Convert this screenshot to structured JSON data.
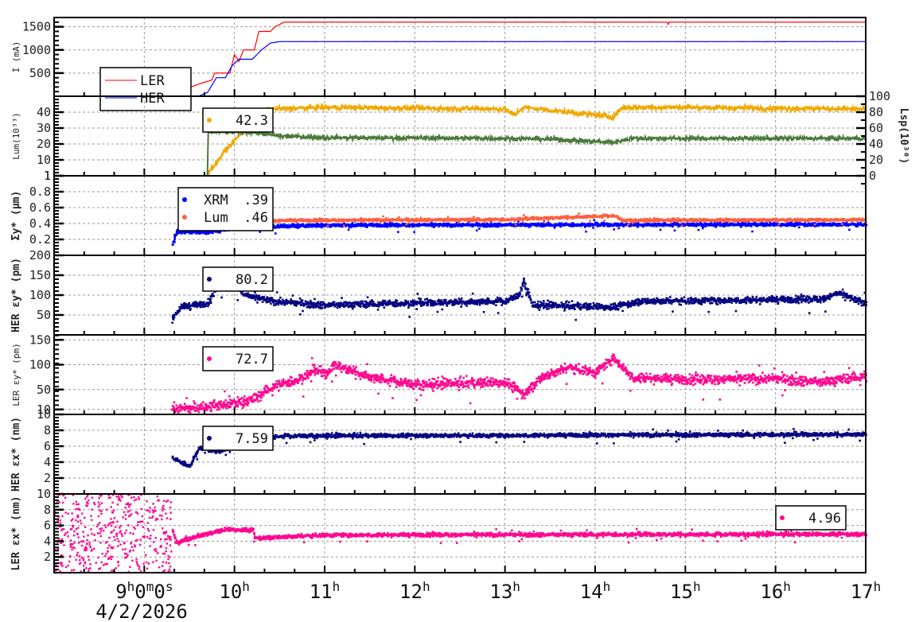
{
  "chart_data": [
    {
      "type": "line",
      "id": "current",
      "ylabel": "I (mA)",
      "ylabel_style": "light",
      "ylim": [
        0,
        1700
      ],
      "yticks": [
        500,
        1000,
        1500
      ],
      "ytick_labels": [
        "500",
        "1000",
        "1500"
      ],
      "series": [
        {
          "name": "LER",
          "color": "#ff0000",
          "noise": 2,
          "points": [
            [
              8,
              0
            ],
            [
              9.3,
              0
            ],
            [
              9.45,
              150
            ],
            [
              9.6,
              260
            ],
            [
              9.75,
              350
            ],
            [
              9.78,
              500
            ],
            [
              9.95,
              500
            ],
            [
              10.0,
              900
            ],
            [
              10.05,
              750
            ],
            [
              10.1,
              1000
            ],
            [
              10.22,
              1000
            ],
            [
              10.27,
              1400
            ],
            [
              10.4,
              1400
            ],
            [
              10.45,
              1500
            ],
            [
              10.55,
              1600
            ],
            [
              14.8,
              1600
            ],
            [
              14.81,
              1550
            ],
            [
              14.82,
              1600
            ],
            [
              17,
              1600
            ]
          ]
        },
        {
          "name": "HER",
          "color": "#0000ff",
          "noise": 2,
          "points": [
            [
              8,
              0
            ],
            [
              9.6,
              0
            ],
            [
              9.7,
              80
            ],
            [
              9.8,
              400
            ],
            [
              9.9,
              400
            ],
            [
              9.97,
              650
            ],
            [
              10.05,
              800
            ],
            [
              10.2,
              800
            ],
            [
              10.3,
              1000
            ],
            [
              10.4,
              1150
            ],
            [
              10.5,
              1180
            ],
            [
              17,
              1180
            ]
          ]
        }
      ],
      "legend": {
        "placement": "left",
        "entries": [
          {
            "label": "LER",
            "color": "#ff0000"
          },
          {
            "label": "HER",
            "color": "#0000ff"
          }
        ]
      }
    },
    {
      "type": "line",
      "id": "luminosity",
      "ylabel": "Lum(10³³)",
      "ylabel_style": "light",
      "ylim": [
        0,
        50
      ],
      "yticks": [
        0,
        10,
        20,
        30,
        40
      ],
      "ytick_labels": [
        "1",
        "10",
        "20",
        "30",
        "40"
      ],
      "y2label": "Lsp(10³⁰)",
      "y2lim": [
        0,
        100
      ],
      "y2ticks": [
        0,
        20,
        40,
        60,
        80,
        100
      ],
      "y2tick_labels": [
        "0",
        "20",
        "40",
        "60",
        "80",
        "100"
      ],
      "series": [
        {
          "name": "Lum",
          "color": "#f0a800",
          "noise": 1.2,
          "points": [
            [
              9.7,
              2
            ],
            [
              9.8,
              8
            ],
            [
              9.9,
              16
            ],
            [
              10.0,
              22
            ],
            [
              10.1,
              28
            ],
            [
              10.2,
              38
            ],
            [
              10.4,
              42
            ],
            [
              11,
              43
            ],
            [
              13,
              42
            ],
            [
              13.1,
              38
            ],
            [
              13.2,
              43
            ],
            [
              14.2,
              37
            ],
            [
              14.3,
              43
            ],
            [
              15,
              43
            ],
            [
              17,
              42
            ]
          ]
        },
        {
          "name": "Lsp",
          "axis": "right",
          "color": "#4a7a3a",
          "noise": 2,
          "points": [
            [
              8,
              0
            ],
            [
              9.7,
              0
            ],
            [
              9.71,
              55
            ],
            [
              10.2,
              55
            ],
            [
              10.5,
              50
            ],
            [
              11,
              48
            ],
            [
              13,
              47
            ],
            [
              13.5,
              46
            ],
            [
              14.2,
              42
            ],
            [
              14.4,
              47
            ],
            [
              17,
              47
            ]
          ]
        }
      ],
      "legend": {
        "placement": "top-left",
        "entries": [
          {
            "label": "42.3",
            "color": "#f0a800"
          }
        ]
      }
    },
    {
      "type": "scatter",
      "id": "sigma-y",
      "ylabel": "Σy* (μm)",
      "ylabel_style": "bold",
      "ylim": [
        0,
        1
      ],
      "yticks": [
        0.2,
        0.4,
        0.6,
        0.8,
        1
      ],
      "ytick_labels": [
        "0.2",
        "0.4",
        "0.6",
        "0.8",
        "1"
      ],
      "series": [
        {
          "name": "XRM",
          "color": "#0000ff",
          "noise": 0.015,
          "points": [
            [
              9.3,
              0.12
            ],
            [
              9.35,
              0.3
            ],
            [
              9.7,
              0.29
            ],
            [
              10.0,
              0.35
            ],
            [
              11,
              0.38
            ],
            [
              17,
              0.39
            ]
          ]
        },
        {
          "name": "Lum",
          "color": "#ff6040",
          "noise": 0.012,
          "points": [
            [
              9.7,
              0.35
            ],
            [
              9.9,
              0.47
            ],
            [
              10.1,
              0.4
            ],
            [
              10.5,
              0.44
            ],
            [
              13,
              0.45
            ],
            [
              14.2,
              0.5
            ],
            [
              14.3,
              0.44
            ],
            [
              17,
              0.45
            ]
          ]
        }
      ],
      "legend": {
        "placement": "top-left",
        "entries": [
          {
            "label": "XRM",
            "value": ".39",
            "color": "#0000ff"
          },
          {
            "label": "Lum",
            "value": ".46",
            "color": "#ff6040"
          }
        ]
      }
    },
    {
      "type": "scatter",
      "id": "her-eps-y",
      "ylabel": "HER εy* (pm)",
      "ylabel_style": "bold",
      "ylim": [
        0,
        200
      ],
      "yticks": [
        50,
        100,
        150,
        200
      ],
      "ytick_labels": [
        "50",
        "100",
        "150",
        "200"
      ],
      "series": [
        {
          "name": "HER εy*",
          "color": "#000080",
          "noise": 6,
          "points": [
            [
              9.3,
              40
            ],
            [
              9.4,
              70
            ],
            [
              9.7,
              80
            ],
            [
              9.8,
              120
            ],
            [
              9.95,
              150
            ],
            [
              10.1,
              100
            ],
            [
              10.4,
              85
            ],
            [
              11,
              75
            ],
            [
              12,
              80
            ],
            [
              13,
              85
            ],
            [
              13.15,
              100
            ],
            [
              13.2,
              135
            ],
            [
              13.3,
              75
            ],
            [
              14.2,
              70
            ],
            [
              14.5,
              85
            ],
            [
              16.5,
              90
            ],
            [
              16.7,
              105
            ],
            [
              16.9,
              85
            ],
            [
              17,
              82
            ]
          ]
        }
      ],
      "legend": {
        "placement": "top-left",
        "entries": [
          {
            "label": "80.2",
            "color": "#000080"
          }
        ]
      }
    },
    {
      "type": "scatter",
      "id": "ler-eps-y",
      "ylabel": "LER εy* (pm)",
      "ylabel_style": "light",
      "ylim": [
        0,
        160
      ],
      "yticks": [
        10,
        50,
        100,
        150
      ],
      "ytick_labels": [
        "10",
        "50",
        "100",
        "150"
      ],
      "series": [
        {
          "name": "LER εy*",
          "color": "#ff0890",
          "noise": 7,
          "points": [
            [
              9.3,
              12
            ],
            [
              9.5,
              12
            ],
            [
              9.9,
              20
            ],
            [
              10.2,
              30
            ],
            [
              10.4,
              55
            ],
            [
              10.7,
              70
            ],
            [
              10.9,
              90
            ],
            [
              11,
              80
            ],
            [
              11.1,
              100
            ],
            [
              11.5,
              75
            ],
            [
              12,
              60
            ],
            [
              13,
              65
            ],
            [
              13.2,
              40
            ],
            [
              13.4,
              75
            ],
            [
              13.7,
              95
            ],
            [
              14,
              85
            ],
            [
              14.2,
              115
            ],
            [
              14.4,
              75
            ],
            [
              15,
              70
            ],
            [
              16,
              72
            ],
            [
              16.5,
              65
            ],
            [
              17,
              78
            ]
          ]
        }
      ],
      "legend": {
        "placement": "top-left",
        "entries": [
          {
            "label": "72.7",
            "color": "#ff0890"
          }
        ]
      }
    },
    {
      "type": "scatter",
      "id": "her-eps-x",
      "ylabel": "HER εx* (nm)",
      "ylabel_style": "bold",
      "ylim": [
        0,
        10
      ],
      "yticks": [
        2,
        4,
        6,
        8,
        10
      ],
      "ytick_labels": [
        "2",
        "4",
        "6",
        "8",
        "10"
      ],
      "series": [
        {
          "name": "HER εx*",
          "color": "#000080",
          "noise": 0.18,
          "points": [
            [
              9.3,
              4.5
            ],
            [
              9.5,
              3.5
            ],
            [
              9.6,
              5.8
            ],
            [
              9.8,
              5.3
            ],
            [
              10.0,
              6
            ],
            [
              10.3,
              6.8
            ],
            [
              10.5,
              7.3
            ],
            [
              17,
              7.5
            ]
          ]
        }
      ],
      "legend": {
        "placement": "top-left",
        "entries": [
          {
            "label": "7.59",
            "color": "#000080"
          }
        ]
      }
    },
    {
      "type": "scatter",
      "id": "ler-eps-x",
      "ylabel": "LER εx* (nm)",
      "ylabel_style": "bold",
      "ylim": [
        0,
        10
      ],
      "yticks": [
        2,
        4,
        6,
        8,
        10
      ],
      "ytick_labels": [
        "2",
        "4",
        "6",
        "8",
        "10"
      ],
      "series": [
        {
          "name": "LER εx*",
          "color": "#ff0890",
          "noise": 0.18,
          "scatter_region": {
            "from": 8,
            "to": 9.3,
            "range": [
              0,
              10
            ]
          },
          "points": [
            [
              9.3,
              5.5
            ],
            [
              9.35,
              3.8
            ],
            [
              9.6,
              4.7
            ],
            [
              9.9,
              5.5
            ],
            [
              10.2,
              5.4
            ],
            [
              10.21,
              4.4
            ],
            [
              11,
              4.8
            ],
            [
              17,
              4.9
            ]
          ]
        }
      ],
      "legend": {
        "placement": "top-right",
        "entries": [
          {
            "label": "4.96",
            "color": "#ff0890"
          }
        ]
      }
    }
  ],
  "xaxis": {
    "xlim": [
      8,
      17
    ],
    "ticks": [
      9,
      10,
      11,
      12,
      13,
      14,
      15,
      16,
      17
    ],
    "tick_labels": [
      "9h0m0s",
      "10h",
      "11h",
      "12h",
      "13h",
      "14h",
      "15h",
      "16h",
      "17h"
    ],
    "date": "4/2/2026"
  }
}
